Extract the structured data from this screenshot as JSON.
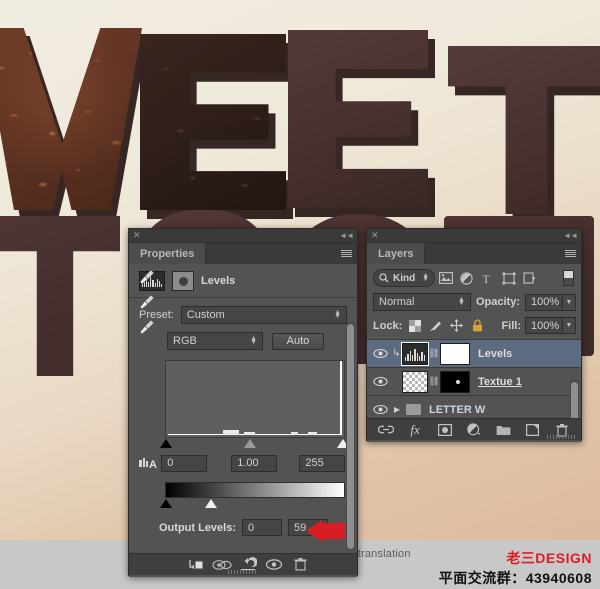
{
  "artwork": {
    "letters": [
      "W",
      "E",
      "E",
      "T"
    ],
    "description": "chocolate-textured 3d letters",
    "background_color": "#efe9da"
  },
  "watermark": {
    "translation_note": "Textbook of translation",
    "brand": "老三DESIGN",
    "qq_group": "平面交流群：43940608",
    "brand_color": "#e01b24"
  },
  "properties_panel": {
    "close_icon": "✕",
    "collapse_icon": "◄◄",
    "tab_label": "Properties",
    "menu_icon": "panel-menu-icon",
    "adjustment_title": "Levels",
    "preset": {
      "label": "Preset:",
      "value": "Custom"
    },
    "channel": {
      "value": "RGB"
    },
    "auto_button": "Auto",
    "eyedroppers": [
      "set-black-point",
      "set-gray-point",
      "set-white-point"
    ],
    "input_levels": {
      "black": "0",
      "gamma": "1.00",
      "white": "255"
    },
    "output_levels": {
      "label": "Output Levels:",
      "black": "0",
      "white": "59"
    },
    "footer_icons": [
      "clip-to-layer-icon",
      "view-previous-state-icon",
      "reset-adjustment-icon",
      "toggle-layer-visibility-icon",
      "delete-adjustment-icon"
    ]
  },
  "layers_panel": {
    "close_icon": "✕",
    "collapse_icon": "◄◄",
    "tab_label": "Layers",
    "menu_icon": "panel-menu-icon",
    "filter": {
      "kind_label": "Kind",
      "icons": [
        "pixel-layers-icon",
        "adjustment-layers-icon",
        "type-layers-icon",
        "shape-layers-icon",
        "smart-object-layers-icon"
      ]
    },
    "blend_mode": "Normal",
    "opacity": {
      "label": "Opacity:",
      "value": "100%"
    },
    "lock": {
      "label": "Lock:",
      "icons": [
        "lock-transparent-pixels-icon",
        "lock-image-pixels-icon",
        "lock-position-icon",
        "lock-all-icon"
      ]
    },
    "fill": {
      "label": "Fill:",
      "value": "100%"
    },
    "layers": [
      {
        "name": "Levels",
        "type": "adjustment",
        "selected": true,
        "clipped": true,
        "visible": true,
        "editing": false
      },
      {
        "name": "Textue 1",
        "type": "pixel",
        "selected": false,
        "clipped": false,
        "visible": true,
        "editing": true
      },
      {
        "name": "LETTER W",
        "type": "group",
        "selected": false,
        "clipped": false,
        "visible": true,
        "editing": false
      }
    ],
    "footer_icons": [
      "link-layers-icon",
      "layer-style-fx-icon",
      "add-layer-mask-icon",
      "new-adjustment-layer-icon",
      "new-group-icon",
      "new-layer-icon",
      "delete-layer-icon"
    ]
  }
}
